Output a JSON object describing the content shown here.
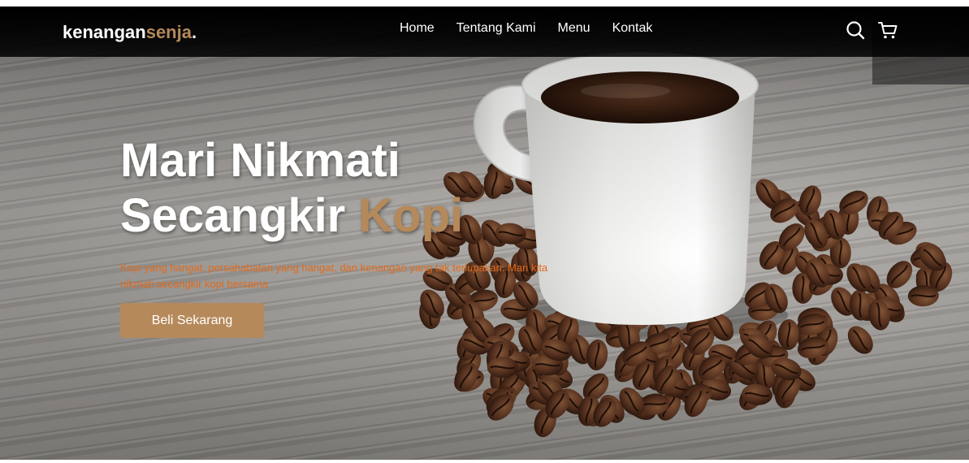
{
  "brand": {
    "name_main": "kenangan",
    "name_accent": "senja",
    "name_dot": "."
  },
  "nav": {
    "links": [
      "Home",
      "Tentang Kami",
      "Menu",
      "Kontak"
    ]
  },
  "icons": {
    "search": "search-icon",
    "cart": "cart-icon"
  },
  "hero": {
    "title_line1": "Mari Nikmati",
    "title_line2_main": "Secangkir ",
    "title_line2_accent": "Kopi",
    "description": "Kopi yang hangat, persahabatan yang hangat, dan kenangan yang tak terlupakan. Mari kita nikmati secangkir kopi bersama",
    "cta_label": "Beli Sekarang"
  },
  "colors": {
    "accent": "#b6895b",
    "description_text": "#e26a1b",
    "navbar": "#000000"
  }
}
